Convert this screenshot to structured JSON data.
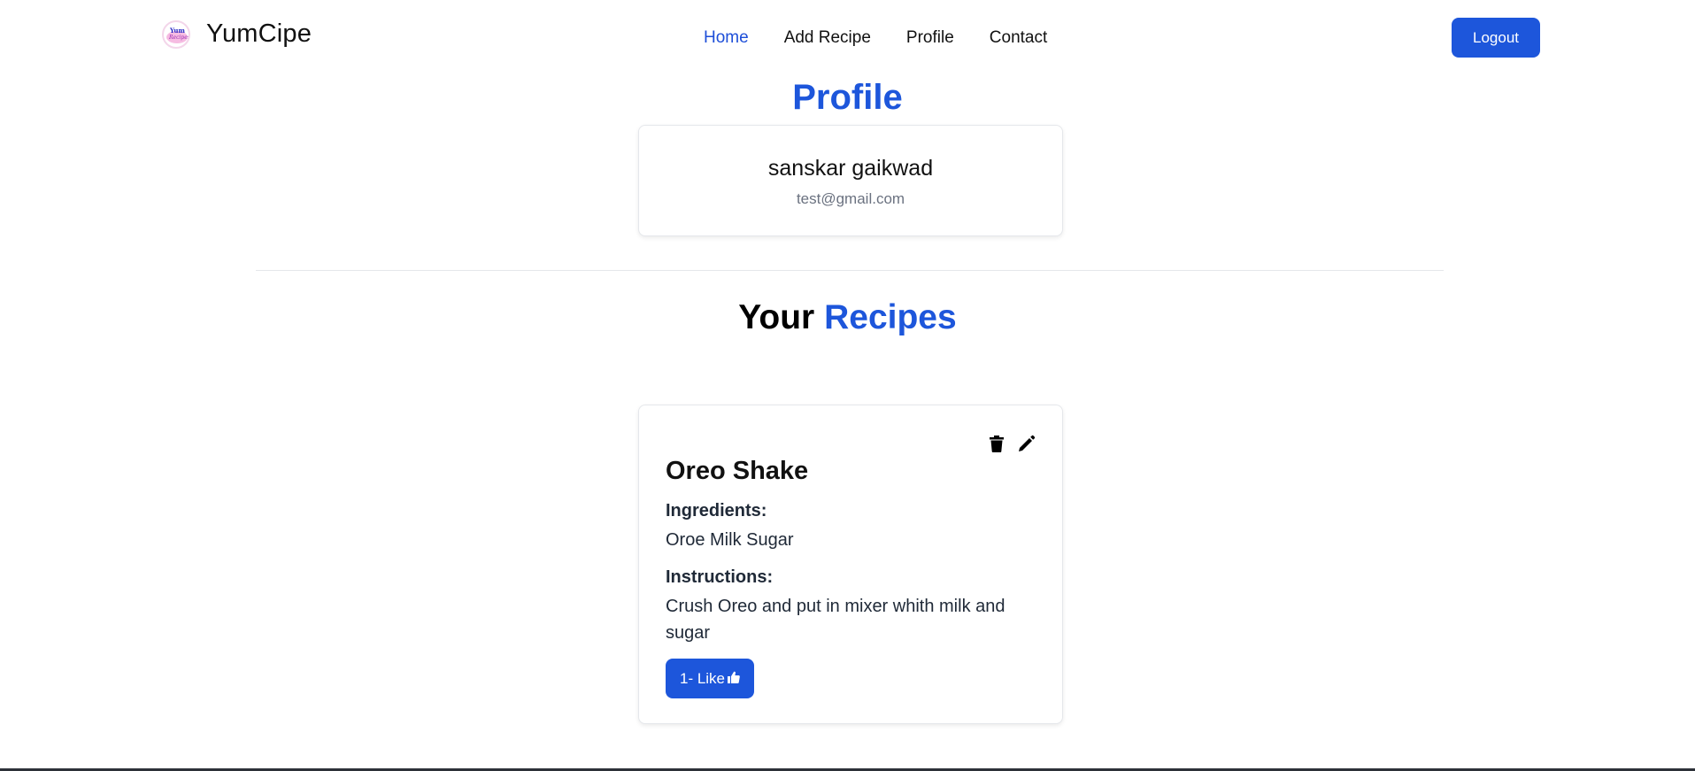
{
  "nav": {
    "brand": "YumCipe",
    "logo_text_top": "Yum",
    "logo_text_bottom": "Recipes",
    "links": [
      {
        "label": "Home",
        "active": true
      },
      {
        "label": "Add Recipe",
        "active": false
      },
      {
        "label": "Profile",
        "active": false
      },
      {
        "label": "Contact",
        "active": false
      }
    ],
    "logout_label": "Logout"
  },
  "profile": {
    "title": "Profile",
    "name": "sanskar gaikwad",
    "email": "test@gmail.com"
  },
  "recipes": {
    "title_prefix": "Your",
    "title_accent": "Recipes",
    "items": [
      {
        "title": "Oreo Shake",
        "ingredients_label": "Ingredients:",
        "ingredients": "Oroe Milk Sugar",
        "instructions_label": "Instructions:",
        "instructions": "Crush Oreo and put in mixer whith milk and sugar",
        "likes_label": "1- Like",
        "actions": [
          "trash-icon",
          "pencil-icon"
        ]
      }
    ]
  },
  "colors": {
    "accent": "#1d56db",
    "text": "#111111",
    "muted": "#6b7280"
  }
}
